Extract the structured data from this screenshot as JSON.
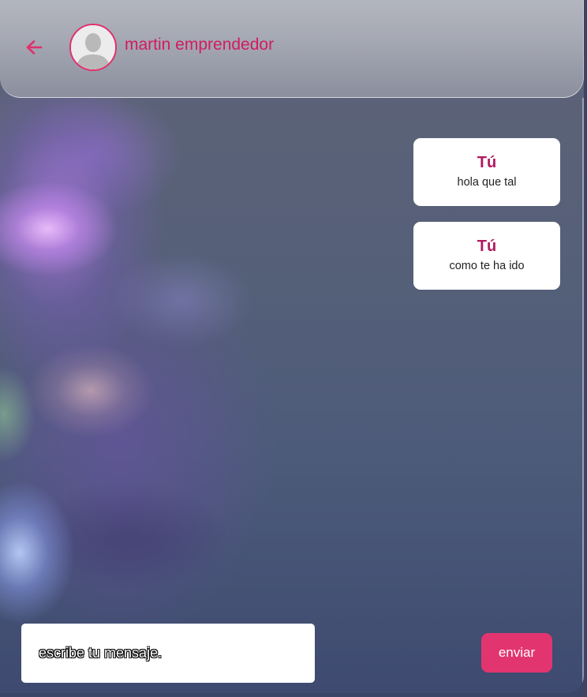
{
  "header": {
    "back_icon": "arrow-left-icon",
    "avatar_icon": "default-user-avatar",
    "contact_name": "martin emprendedor"
  },
  "messages": [
    {
      "sender": "Tú",
      "text": "hola que tal"
    },
    {
      "sender": "Tú",
      "text": "como te ha ido"
    }
  ],
  "composer": {
    "placeholder": "escribe tu mensaje.",
    "value": "",
    "send_label": "enviar"
  },
  "colors": {
    "accent": "#e2356f",
    "name_color": "#d11b63",
    "sender_color": "#b0195f"
  }
}
